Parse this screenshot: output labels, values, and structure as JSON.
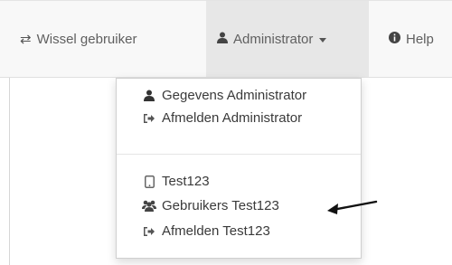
{
  "navbar": {
    "switch_user": {
      "label": "Wissel gebruiker",
      "icon": "switch-arrows-icon"
    },
    "account_menu": {
      "label": "Administrator",
      "icon": "user-icon"
    },
    "help": {
      "label": "Help",
      "icon": "info-circle-icon"
    }
  },
  "dropdown": {
    "items": [
      {
        "label": "Gegevens Administrator",
        "icon": "user-icon"
      },
      {
        "label": "Afmelden Administrator",
        "icon": "sign-out-icon"
      },
      {
        "label": "Test123",
        "icon": "tablet-icon"
      },
      {
        "label": "Gebruikers Test123",
        "icon": "users-icon"
      },
      {
        "label": "Afmelden Test123",
        "icon": "sign-out-icon"
      }
    ]
  }
}
